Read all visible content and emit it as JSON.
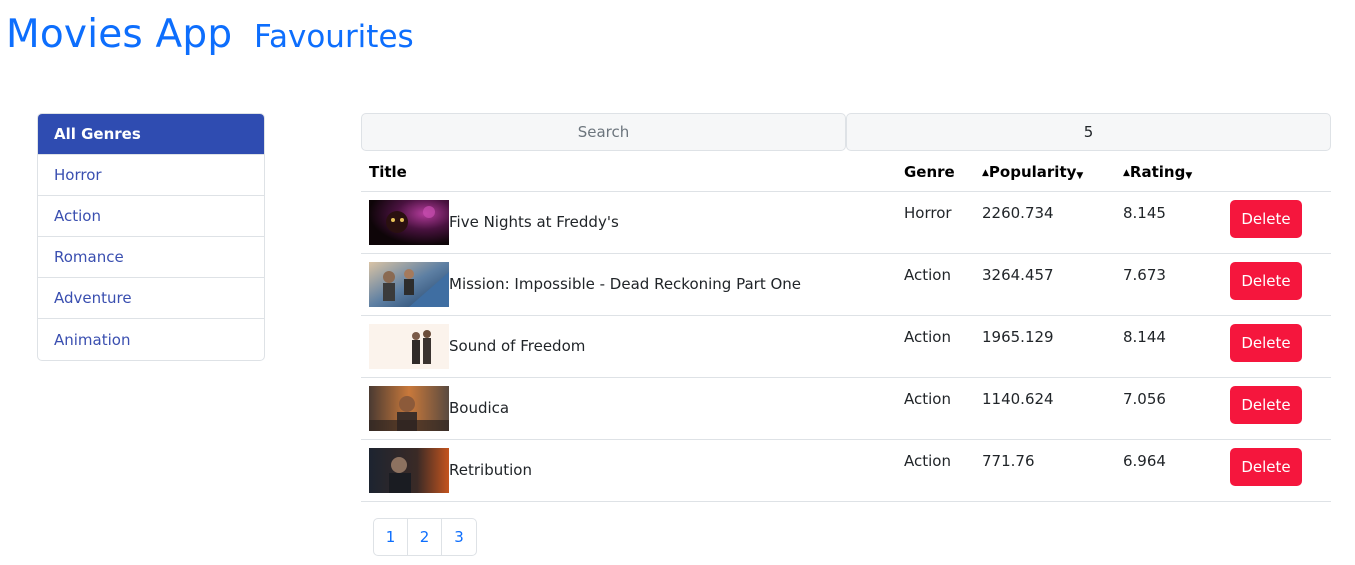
{
  "nav": {
    "brand": "Movies App",
    "favourites": "Favourites"
  },
  "genres": [
    "All Genres",
    "Horror",
    "Action",
    "Romance",
    "Adventure",
    "Animation"
  ],
  "search": {
    "placeholder": "Search",
    "page_size_value": "5"
  },
  "table": {
    "headers": {
      "title": "Title",
      "genre": "Genre",
      "popularity": "Popularity",
      "rating": "Rating"
    },
    "sort_icons": {
      "up": "▲",
      "down": "▼"
    },
    "rows": [
      {
        "title": "Five Nights at Freddy's",
        "genre": "Horror",
        "popularity": "2260.734",
        "rating": "8.145",
        "action": "Delete"
      },
      {
        "title": "Mission: Impossible - Dead Reckoning Part One",
        "genre": "Action",
        "popularity": "3264.457",
        "rating": "7.673",
        "action": "Delete"
      },
      {
        "title": "Sound of Freedom",
        "genre": "Action",
        "popularity": "1965.129",
        "rating": "8.144",
        "action": "Delete"
      },
      {
        "title": "Boudica",
        "genre": "Action",
        "popularity": "1140.624",
        "rating": "7.056",
        "action": "Delete"
      },
      {
        "title": "Retribution",
        "genre": "Action",
        "popularity": "771.76",
        "rating": "6.964",
        "action": "Delete"
      }
    ]
  },
  "pagination": [
    "1",
    "2",
    "3"
  ],
  "colors": {
    "link": "#0d6efd",
    "active_genre": "#2f4cb1",
    "delete": "#f5163d"
  }
}
